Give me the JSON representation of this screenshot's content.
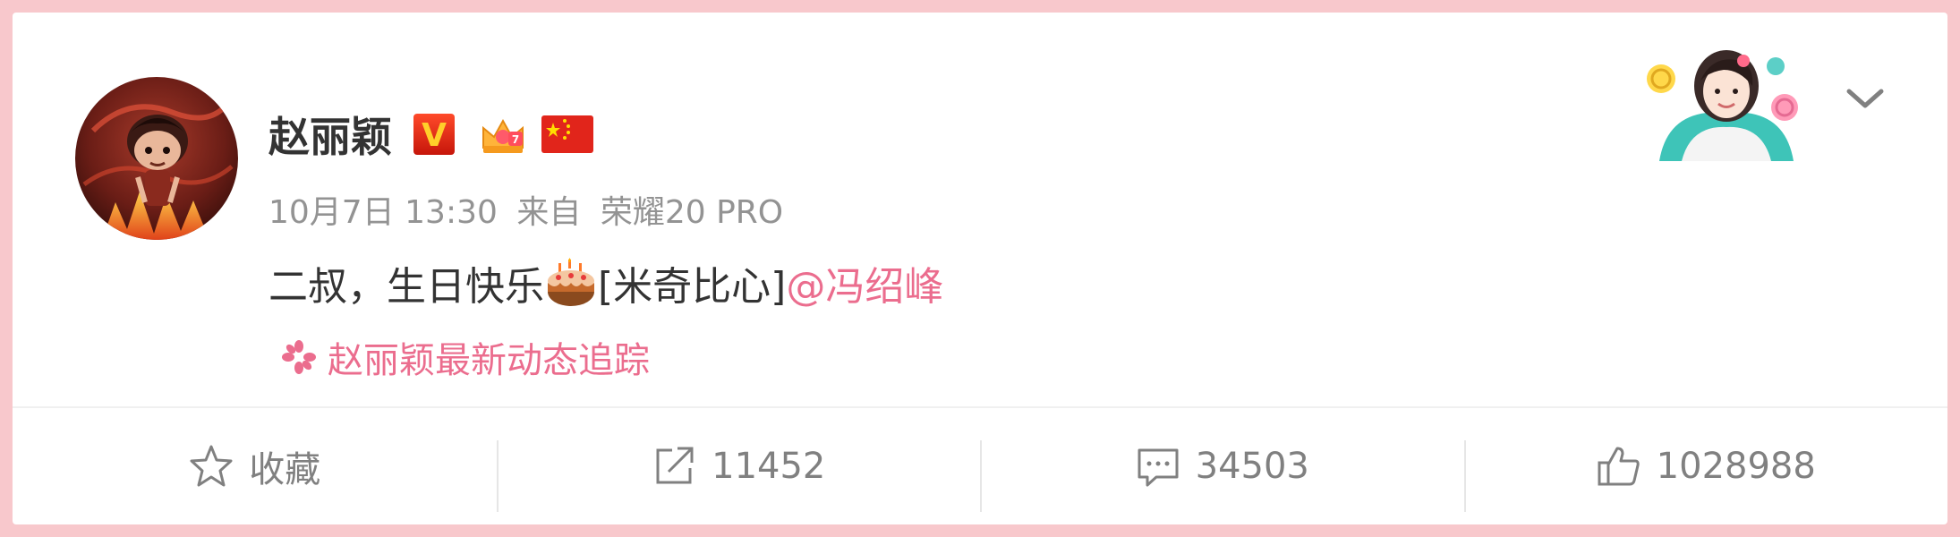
{
  "post": {
    "author": "赵丽颖",
    "timestamp": "10月7日 13:30",
    "source_prefix": "来自",
    "device": "荣耀20 PRO",
    "text": "二叔，生日快乐",
    "emoji_text": "[米奇比心]",
    "mention": "@冯绍峰",
    "tracker_label": "赵丽颖最新动态追踪"
  },
  "badges": {
    "verified": "V"
  },
  "actions": {
    "favorite_label": "收藏",
    "repost_count": "11452",
    "comment_count": "34503",
    "like_count": "1028988"
  },
  "colors": {
    "background": "#f8c8cc",
    "card": "#ffffff",
    "text": "#333333",
    "meta": "#939393",
    "link": "#eb6d8e",
    "action_text": "#808080"
  },
  "icons": {
    "avatar": "cartoon-avatar",
    "verified": "verified-v-badge",
    "member": "crown-member-icon",
    "flag": "china-flag-icon",
    "cake": "birthday-cake-emoji",
    "tracker": "flower-icon",
    "decor": "card-decoration-figure",
    "menu": "chevron-down-icon",
    "favorite": "star-icon",
    "repost": "share-icon",
    "comment": "comment-icon",
    "like": "thumbs-up-icon"
  }
}
